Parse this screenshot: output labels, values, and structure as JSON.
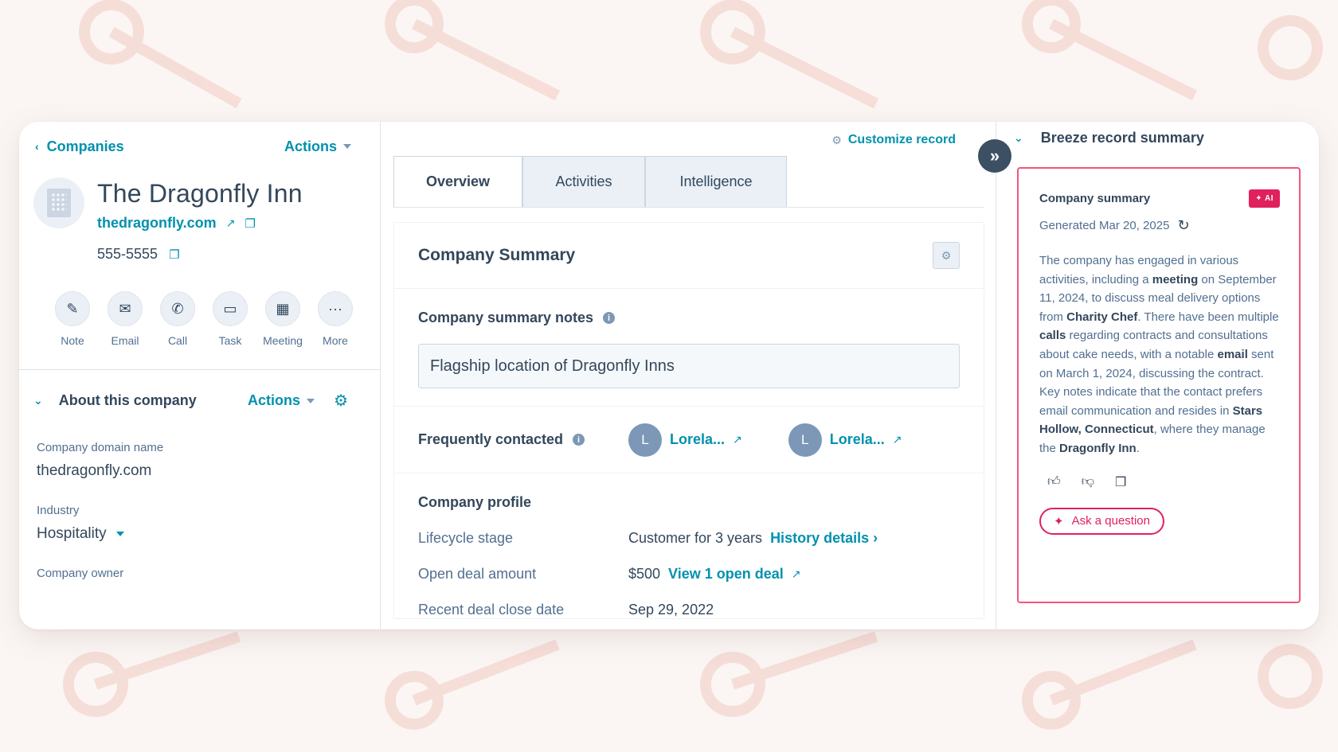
{
  "colors": {
    "accent": "#0091ae",
    "ai": "#e0215e",
    "text": "#33475b",
    "muted": "#516f90"
  },
  "left": {
    "back_label": "Companies",
    "actions_label": "Actions",
    "company_name": "The Dragonfly Inn",
    "domain": "thedragonfly.com",
    "phone": "555-5555",
    "quick_actions": [
      {
        "label": "Note",
        "icon": "note-icon"
      },
      {
        "label": "Email",
        "icon": "email-icon"
      },
      {
        "label": "Call",
        "icon": "call-icon"
      },
      {
        "label": "Task",
        "icon": "task-icon"
      },
      {
        "label": "Meeting",
        "icon": "meeting-icon"
      },
      {
        "label": "More",
        "icon": "more-icon"
      }
    ],
    "about": {
      "title": "About this company",
      "actions_label": "Actions",
      "properties": [
        {
          "label": "Company domain name",
          "value": "thedragonfly.com"
        },
        {
          "label": "Industry",
          "value": "Hospitality"
        },
        {
          "label": "Company owner",
          "value": ""
        }
      ]
    }
  },
  "middle": {
    "customize_label": "Customize record",
    "tabs": [
      {
        "label": "Overview",
        "active": true
      },
      {
        "label": "Activities",
        "active": false
      },
      {
        "label": "Intelligence",
        "active": false
      }
    ],
    "summary_title": "Company Summary",
    "notes_label": "Company summary notes",
    "notes_value": "Flagship location of Dragonfly Inns",
    "freq_label": "Frequently contacted",
    "contacts": [
      {
        "initial": "L",
        "name": "Lorela..."
      },
      {
        "initial": "L",
        "name": "Lorela..."
      }
    ],
    "profile": {
      "title": "Company profile",
      "rows": [
        {
          "label": "Lifecycle stage",
          "value": "Customer for 3 years",
          "link": "History details ›"
        },
        {
          "label": "Open deal amount",
          "value": "$500",
          "link": "View 1 open deal"
        },
        {
          "label": "Recent deal close date",
          "value": "Sep 29, 2022",
          "link": ""
        }
      ]
    }
  },
  "right": {
    "title": "Breeze record summary",
    "card_title": "Company summary",
    "ai_badge": "✦ AI",
    "generated": "Generated Mar 20, 2025",
    "ask_label": "Ask a question"
  }
}
